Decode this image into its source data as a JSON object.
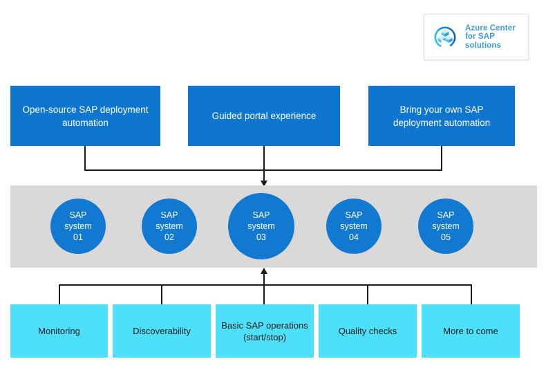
{
  "logo": {
    "icon": "azure-cubes-ring-icon",
    "line1": "Azure Center",
    "line2": "for SAP",
    "line3": "solutions",
    "text_color": "#3d9bdc"
  },
  "top_row": {
    "boxes": [
      {
        "label": "Open-source SAP deployment automation"
      },
      {
        "label": "Guided portal experience"
      },
      {
        "label": "Bring your own SAP deployment automation"
      }
    ],
    "fill_color": "#0f76d0",
    "text_color": "#ffffff"
  },
  "band": {
    "fill_color": "#d9d9d9",
    "circles": [
      {
        "line1": "SAP",
        "line2": "system",
        "line3": "01",
        "size": 80
      },
      {
        "line1": "SAP",
        "line2": "system",
        "line3": "02",
        "size": 80
      },
      {
        "line1": "SAP",
        "line2": "system",
        "line3": "03",
        "size": 96
      },
      {
        "line1": "SAP",
        "line2": "system",
        "line3": "04",
        "size": 80
      },
      {
        "line1": "SAP",
        "line2": "system",
        "line3": "05",
        "size": 80
      }
    ],
    "circle_color": "#1279d0"
  },
  "bottom_row": {
    "boxes": [
      {
        "label": "Monitoring"
      },
      {
        "label": "Discoverability"
      },
      {
        "label": "Basic SAP operations (start/stop)"
      },
      {
        "label": "Quality checks"
      },
      {
        "label": "More to come"
      }
    ],
    "fill_color": "#4ee0fb",
    "text_color": "#1c1c1c"
  },
  "connectors": {
    "line_color": "#1a1a1a",
    "top_arrow": "arrow-down-to-band",
    "bottom_arrow": "arrow-up-to-band"
  }
}
